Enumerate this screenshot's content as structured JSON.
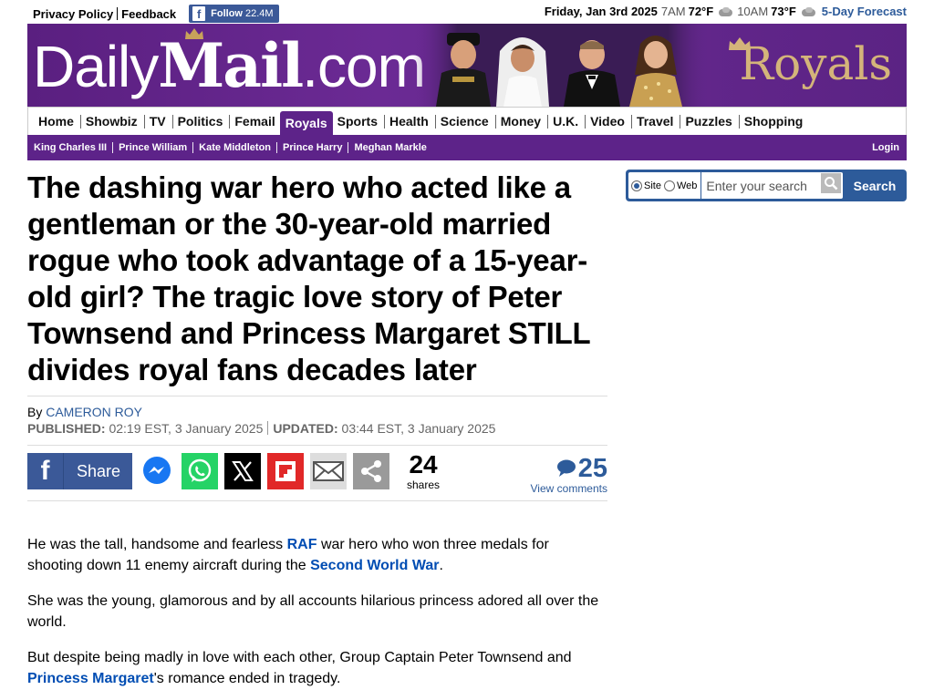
{
  "topbar": {
    "privacy_policy": "Privacy Policy",
    "feedback": "Feedback",
    "fb_follow_label": "Follow",
    "fb_follow_count": "22.4M",
    "date": "Friday, Jan 3rd 2025",
    "weather": [
      {
        "time": "7AM",
        "temp": "72°F"
      },
      {
        "time": "10AM",
        "temp": "73°F"
      }
    ],
    "forecast_link": "5-Day Forecast"
  },
  "masthead": {
    "logo_daily": "Daily",
    "logo_mail": "Mail",
    "logo_com": ".com",
    "section_label": "Royals",
    "brand_color": "#5d2389"
  },
  "nav": {
    "items": [
      {
        "label": "Home",
        "active": false
      },
      {
        "label": "Showbiz",
        "active": false
      },
      {
        "label": "TV",
        "active": false
      },
      {
        "label": "Politics",
        "active": false
      },
      {
        "label": "Femail",
        "active": false
      },
      {
        "label": "Royals",
        "active": true
      },
      {
        "label": "Sports",
        "active": false
      },
      {
        "label": "Health",
        "active": false
      },
      {
        "label": "Science",
        "active": false
      },
      {
        "label": "Money",
        "active": false
      },
      {
        "label": "U.K.",
        "active": false
      },
      {
        "label": "Video",
        "active": false
      },
      {
        "label": "Travel",
        "active": false
      },
      {
        "label": "Puzzles",
        "active": false
      },
      {
        "label": "Shopping",
        "active": false
      }
    ]
  },
  "subnav": {
    "items": [
      "King Charles III",
      "Prince William",
      "Kate Middleton",
      "Prince Harry",
      "Meghan Markle"
    ],
    "login": "Login"
  },
  "search": {
    "radio_site": "Site",
    "radio_web": "Web",
    "selected": "Site",
    "placeholder": "Enter your search",
    "button": "Search"
  },
  "article": {
    "headline": "The dashing war hero who acted like a gentleman or the 30-year-old married rogue who took advantage of a 15-year-old girl? The tragic love story of Peter Townsend and Princess Margaret STILL divides royal fans decades later",
    "by": "By",
    "author": "CAMERON ROY",
    "published_label": "PUBLISHED:",
    "published": "02:19 EST, 3 January 2025",
    "updated_label": "UPDATED:",
    "updated": "03:44 EST, 3 January 2025",
    "share_label": "Share",
    "shares_count": "24",
    "shares_label": "shares",
    "comments_count": "25",
    "comments_link": "View comments",
    "p1": {
      "a": "He was the tall, handsome and fearless ",
      "link1": "RAF",
      "b": " war hero who won three medals for shooting down 11 enemy aircraft during the ",
      "link2": "Second World War",
      "c": "."
    },
    "p2": "She was the young, glamorous and by all accounts hilarious princess adored all over the world.",
    "p3": {
      "a": "But despite being madly in love with each other, Group Captain Peter Townsend and ",
      "link": "Princess Margaret",
      "b": "'s romance ended in tragedy."
    }
  }
}
